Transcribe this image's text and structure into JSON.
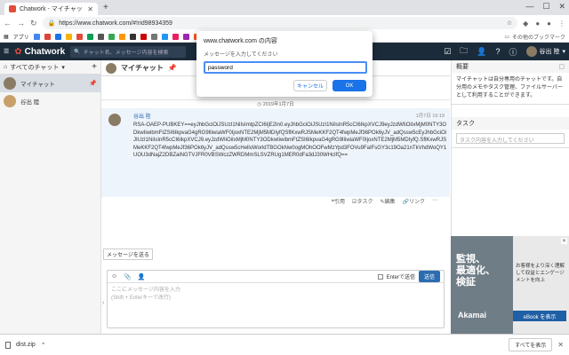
{
  "browser": {
    "tab_title": "Chatwork - マイチャット",
    "new_tab": "+",
    "url": "https://www.chatwork.com/#!rid98934359",
    "bookmarks_label": "アプリ",
    "other_bookmarks": "その他のブックマーク"
  },
  "header": {
    "logo": "Chatwork",
    "search_placeholder": "チャット名、メッセージ内容を検索",
    "user_name": "谷出 陸"
  },
  "sidebar": {
    "filter_label": "すべてのチャット",
    "rooms": [
      {
        "label": "マイチャット",
        "active": true
      },
      {
        "label": "谷出 陸",
        "active": false
      }
    ]
  },
  "chat": {
    "title": "マイチャット",
    "date": "2019年1月7日",
    "message": {
      "author": "谷出 陸",
      "time": "1月7日 19:19",
      "body": "RSA-OAEP-PUBKEY==eyJhbGciOiJSUzI1NiIsImtpZCI6IjE2In0.eyJhbGciOiJSUzI1NiIsInR5cCI6IkpXVCJ9eyJzdWIiOiIxMjM0NTY3ODkwIiwibmFtZSI6IkpvaG4gRG9lIiwiaWF0IjoxNTE2MjM5MDIyfQSflKxwRJSMeKKF2QT4fwpMeJf36POk6yJV_adQssw5cEyJhbGciOiJIUzI1NiIsInR5cCI6IkpXVCJ9.eyJzdWIiOiIxMjM0NTY3ODkwIiwibmFtZSI6IkpvaG4gRG9lIiwiaWF0IjoxNTE2MjM5MDIyfQ.SflKxwRJSMeKKF2QT4fwpMeJf36POk6yJV_adQssw5cHelloWorldTBGOkNw0ogMOhOOFwMzYpd3FOVu9FaIFsGY3c19Oa21nTkVhdWoQY1UOU3dNajZ2DBZaiNGTVJFR0VBSWczZWRDMmSLSVZRUg1MER0dFa3dJ30WHcIfQ=="
    },
    "tooltip": "メッセージを送る",
    "actions": [
      "引用",
      "タスク",
      "編集",
      "リンク",
      "⋯"
    ],
    "composer": {
      "enter_send": "Enterで送信",
      "send": "送信",
      "placeholder1": "ここにメッセージ内容を入力",
      "placeholder2": "(Shift + Enterキーで改行)"
    }
  },
  "right_panel": {
    "overview_title": "概要",
    "overview_body": "マイチャットは自分専用のチャットです。自分用のメモやタスク管理、ファイルサーバーとして利用することができます。",
    "task_title": "タスク",
    "task_placeholder": "タスク内容を入力してください"
  },
  "ad": {
    "headline_1": "監視、",
    "headline_2": "最適化、",
    "headline_3": "検証",
    "brand": "Akamai",
    "copy": "お客様をより深く理解して収益とエンゲージメントを向上",
    "cta": "eBook を表示"
  },
  "downloads": {
    "file": "dist.zip",
    "show_all": "すべてを表示"
  },
  "dialog": {
    "title": "www.chatwork.com の内容",
    "message": "メッセージを入力してください",
    "input_value": "password",
    "cancel": "キャンセル",
    "ok": "OK"
  }
}
